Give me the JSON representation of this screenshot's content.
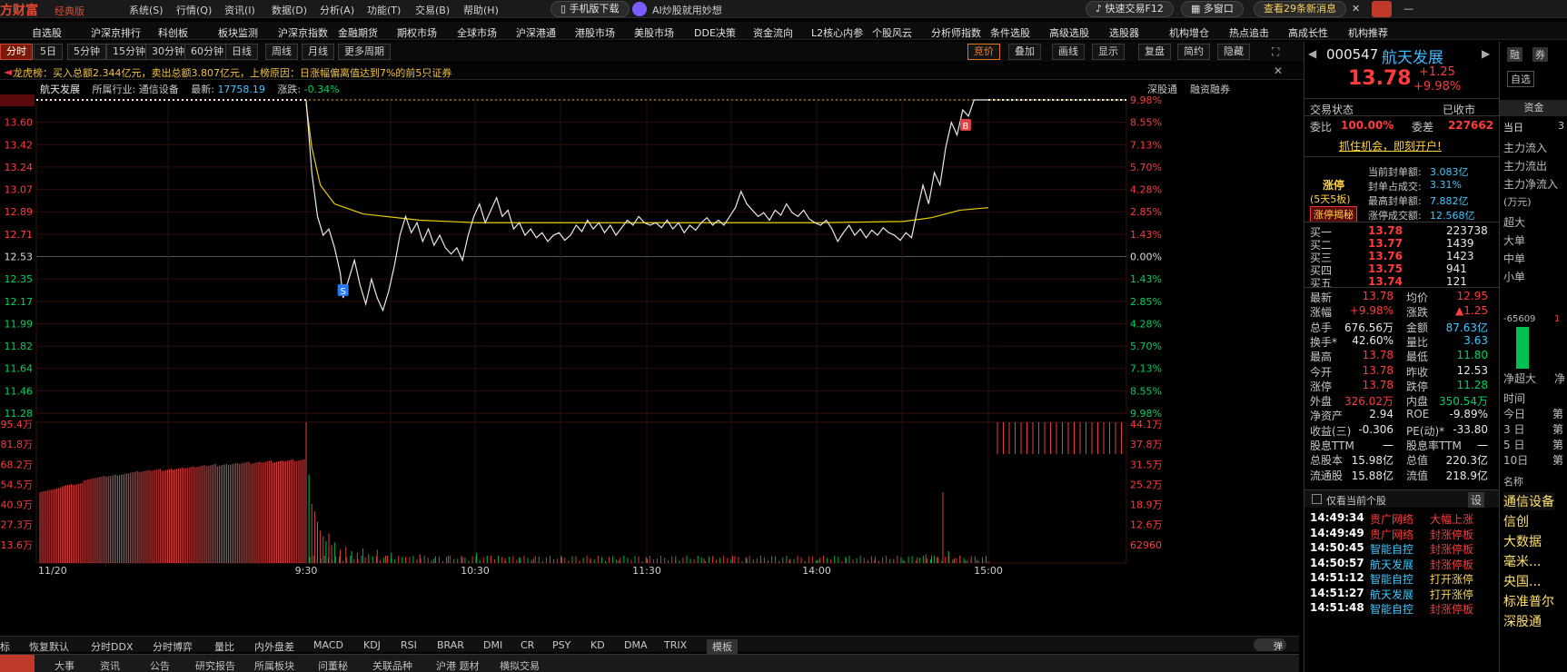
{
  "app": {
    "logo": "方财富",
    "edition": "经典版",
    "menus": [
      "系统(S)",
      "行情(Q)",
      "资讯(I)",
      "数据(D)",
      "分析(A)",
      "功能(T)",
      "交易(B)",
      "帮助(H)"
    ],
    "mobile_download": "手机版下载",
    "ai_label": "AI炒股就用妙想",
    "fast_trade": "快速交易F12",
    "multi_window": "多窗口",
    "messages": "查看29条新消息"
  },
  "nav": [
    "自选股",
    "沪深京排行",
    "科创板",
    "板块监测",
    "沪深京指数",
    "金融期货",
    "期权市场",
    "全球市场",
    "沪深港通",
    "港股市场",
    "美股市场",
    "DDE决策",
    "资金流向",
    "L2核心内参",
    "个股风云",
    "分析师指数",
    "条件选股",
    "高级选股",
    "选股器",
    "机构增仓",
    "热点追击",
    "高成长性",
    "机构推荐"
  ],
  "periods": [
    "分时",
    "5日",
    "5分钟",
    "15分钟",
    "30分钟",
    "60分钟",
    "日线",
    "周线",
    "月线",
    "更多周期"
  ],
  "chart_tools": [
    "竞价",
    "叠加",
    "画线",
    "显示",
    "复盘",
    "简约",
    "隐藏"
  ],
  "notice": "龙虎榜：买入总额2.344亿元，卖出总额3.807亿元，上榜原因：日涨幅偏离值达到7%的前5只证券",
  "chart_header": {
    "name": "航天发展",
    "industry_label": "所属行业:",
    "industry": "通信设备",
    "latest_label": "最新:",
    "latest": "17758.19",
    "change_label": "涨跌:",
    "change": "-0.34%",
    "right1": "深股通",
    "right2": "融资融券"
  },
  "chart_data": {
    "type": "line",
    "price_ticks": [
      "13.78",
      "13.60",
      "13.42",
      "13.24",
      "13.07",
      "12.89",
      "12.71",
      "12.53",
      "12.35",
      "12.17",
      "11.99",
      "11.82",
      "11.64",
      "11.46",
      "11.28"
    ],
    "pct_ticks": [
      "9.98%",
      "8.55%",
      "7.13%",
      "5.70%",
      "4.28%",
      "2.85%",
      "1.43%",
      "0.00%",
      "1.43%",
      "2.85%",
      "4.28%",
      "5.70%",
      "7.13%",
      "8.55%",
      "9.98%"
    ],
    "vol_ticks": [
      "95.4万",
      "81.8万",
      "68.2万",
      "54.5万",
      "40.9万",
      "27.3万",
      "13.6万"
    ],
    "vol_right_ticks": [
      "44.1万",
      "37.8万",
      "31.5万",
      "25.2万",
      "18.9万",
      "12.6万",
      "62960"
    ],
    "time_ticks": [
      "11/20",
      "9:30",
      "10:30",
      "11:30",
      "14:00",
      "15:00"
    ],
    "y_range": [
      11.28,
      13.78
    ],
    "prev_close": 12.53,
    "price_series": [
      [
        0,
        13.78
      ],
      [
        2,
        13.2
      ],
      [
        4,
        12.85
      ],
      [
        6,
        12.7
      ],
      [
        8,
        12.75
      ],
      [
        10,
        12.6
      ],
      [
        12,
        12.4
      ],
      [
        13,
        12.2
      ],
      [
        15,
        12.35
      ],
      [
        17,
        12.5
      ],
      [
        19,
        12.3
      ],
      [
        21,
        12.15
      ],
      [
        23,
        12.35
      ],
      [
        25,
        12.2
      ],
      [
        27,
        12.1
      ],
      [
        29,
        12.25
      ],
      [
        31,
        12.45
      ],
      [
        33,
        12.7
      ],
      [
        35,
        12.85
      ],
      [
        37,
        12.72
      ],
      [
        39,
        12.8
      ],
      [
        41,
        12.65
      ],
      [
        43,
        12.75
      ],
      [
        45,
        12.62
      ],
      [
        47,
        12.7
      ],
      [
        49,
        12.6
      ],
      [
        51,
        12.55
      ],
      [
        53,
        12.6
      ],
      [
        55,
        12.5
      ],
      [
        57,
        12.7
      ],
      [
        59,
        12.85
      ],
      [
        61,
        12.95
      ],
      [
        63,
        12.8
      ],
      [
        65,
        12.9
      ],
      [
        67,
        13.0
      ],
      [
        69,
        12.85
      ],
      [
        71,
        12.9
      ],
      [
        73,
        12.75
      ],
      [
        75,
        12.8
      ],
      [
        77,
        12.7
      ],
      [
        79,
        12.75
      ],
      [
        81,
        12.68
      ],
      [
        83,
        12.72
      ],
      [
        85,
        12.65
      ],
      [
        87,
        12.7
      ],
      [
        89,
        12.72
      ],
      [
        91,
        12.66
      ],
      [
        93,
        12.7
      ],
      [
        95,
        12.78
      ],
      [
        97,
        12.73
      ],
      [
        99,
        12.82
      ],
      [
        101,
        12.75
      ],
      [
        103,
        12.8
      ],
      [
        105,
        12.72
      ],
      [
        107,
        12.78
      ],
      [
        109,
        12.7
      ],
      [
        111,
        12.76
      ],
      [
        113,
        12.82
      ],
      [
        115,
        12.78
      ],
      [
        117,
        12.85
      ],
      [
        119,
        12.8
      ],
      [
        121,
        12.78
      ],
      [
        123,
        12.8
      ],
      [
        125,
        12.76
      ],
      [
        127,
        12.82
      ],
      [
        129,
        12.75
      ],
      [
        131,
        12.8
      ],
      [
        133,
        12.72
      ],
      [
        135,
        12.78
      ],
      [
        137,
        12.74
      ],
      [
        139,
        12.8
      ],
      [
        141,
        12.84
      ],
      [
        143,
        12.78
      ],
      [
        145,
        12.82
      ],
      [
        147,
        12.78
      ],
      [
        149,
        12.85
      ],
      [
        151,
        12.92
      ],
      [
        153,
        13.05
      ],
      [
        155,
        12.95
      ],
      [
        157,
        12.9
      ],
      [
        159,
        12.85
      ],
      [
        161,
        12.88
      ],
      [
        163,
        12.82
      ],
      [
        165,
        12.9
      ],
      [
        167,
        12.86
      ],
      [
        169,
        12.95
      ],
      [
        171,
        12.88
      ],
      [
        173,
        12.85
      ],
      [
        175,
        12.9
      ],
      [
        177,
        12.83
      ],
      [
        179,
        12.8
      ],
      [
        181,
        12.78
      ],
      [
        183,
        12.82
      ],
      [
        185,
        12.75
      ],
      [
        187,
        12.65
      ],
      [
        189,
        12.72
      ],
      [
        191,
        12.78
      ],
      [
        193,
        12.7
      ],
      [
        195,
        12.75
      ],
      [
        197,
        12.68
      ],
      [
        199,
        12.74
      ],
      [
        201,
        12.7
      ],
      [
        203,
        12.76
      ],
      [
        205,
        12.72
      ],
      [
        207,
        12.7
      ],
      [
        209,
        12.66
      ],
      [
        211,
        12.72
      ],
      [
        213,
        12.68
      ],
      [
        215,
        12.9
      ],
      [
        217,
        13.1
      ],
      [
        219,
        12.95
      ],
      [
        221,
        13.2
      ],
      [
        223,
        13.1
      ],
      [
        225,
        13.4
      ],
      [
        227,
        13.6
      ],
      [
        229,
        13.5
      ],
      [
        231,
        13.7
      ],
      [
        233,
        13.65
      ],
      [
        235,
        13.78
      ],
      [
        240,
        13.78
      ]
    ],
    "avg_series": [
      [
        0,
        13.75
      ],
      [
        2,
        13.4
      ],
      [
        5,
        13.1
      ],
      [
        10,
        12.95
      ],
      [
        20,
        12.87
      ],
      [
        40,
        12.82
      ],
      [
        60,
        12.8
      ],
      [
        100,
        12.8
      ],
      [
        140,
        12.8
      ],
      [
        180,
        12.8
      ],
      [
        210,
        12.81
      ],
      [
        220,
        12.84
      ],
      [
        230,
        12.9
      ],
      [
        240,
        12.92
      ]
    ],
    "volume_series": [
      [
        0,
        95.4
      ],
      [
        1,
        60
      ],
      [
        2,
        40
      ],
      [
        3,
        35
      ],
      [
        4,
        28
      ],
      [
        5,
        22
      ],
      [
        6,
        18
      ],
      [
        7,
        15
      ],
      [
        8,
        20
      ],
      [
        9,
        12
      ],
      [
        10,
        14
      ],
      [
        12,
        9
      ],
      [
        14,
        11
      ],
      [
        16,
        8
      ],
      [
        18,
        7
      ],
      [
        20,
        10
      ],
      [
        22,
        6
      ],
      [
        25,
        9
      ],
      [
        28,
        5
      ],
      [
        30,
        7
      ],
      [
        35,
        4
      ],
      [
        40,
        6
      ],
      [
        45,
        3
      ],
      [
        50,
        5
      ],
      [
        55,
        4
      ],
      [
        60,
        7
      ],
      [
        65,
        5
      ],
      [
        70,
        3
      ],
      [
        75,
        4
      ],
      [
        80,
        3
      ],
      [
        90,
        4
      ],
      [
        100,
        3
      ],
      [
        110,
        2
      ],
      [
        120,
        3
      ],
      [
        130,
        2
      ],
      [
        140,
        3
      ],
      [
        150,
        5
      ],
      [
        155,
        3
      ],
      [
        160,
        2
      ],
      [
        170,
        2
      ],
      [
        180,
        2
      ],
      [
        190,
        3
      ],
      [
        200,
        2
      ],
      [
        210,
        2
      ],
      [
        215,
        4
      ],
      [
        218,
        6
      ],
      [
        220,
        5
      ],
      [
        222,
        4
      ],
      [
        224,
        48
      ],
      [
        226,
        8
      ],
      [
        228,
        3
      ],
      [
        230,
        5
      ],
      [
        232,
        2
      ],
      [
        234,
        3
      ],
      [
        236,
        2
      ],
      [
        238,
        2
      ],
      [
        240,
        1
      ]
    ],
    "auction_volume_series": [
      60,
      62,
      65,
      66,
      70,
      72,
      73,
      74,
      76,
      77,
      78,
      78,
      79,
      80,
      81,
      82,
      82,
      83,
      84,
      84,
      85,
      85,
      86,
      86
    ],
    "markers": [
      {
        "label": "S",
        "x": 13
      },
      {
        "label": "B",
        "x": 232
      }
    ]
  },
  "indicator_tabs": [
    "标",
    "恢复默认",
    "分时DDX",
    "分时博弈",
    "量比",
    "内外盘差",
    "MACD",
    "KDJ",
    "RSI",
    "BRAR",
    "DMI",
    "CR",
    "PSY",
    "KD",
    "DMA",
    "TRIX",
    "模板"
  ],
  "bottom_tabs": [
    "大事",
    "资讯",
    "公告",
    "研究报告",
    "所属板块",
    "问董秘",
    "关联品种",
    "沪港 题材",
    "横拟交易"
  ],
  "stock": {
    "code": "000547",
    "name": "航天发展",
    "price": "13.78",
    "change": "+1.25",
    "change_pct": "+9.98%",
    "status_label": "交易状态",
    "status": "已收市",
    "weibi_label": "委比",
    "weibi": "100.00%",
    "weicha_label": "委差",
    "weicha": "227662",
    "promo": "抓住机会，即刻开户!",
    "limit_label": "涨停",
    "limit_sub": "(5天5板)",
    "limit_btn": "涨停揭秘",
    "limit_stats": [
      {
        "label": "当前封单额:",
        "value": "3.083亿"
      },
      {
        "label": "封单占成交:",
        "value": "3.31%"
      },
      {
        "label": "最高封单额:",
        "value": "7.882亿"
      },
      {
        "label": "涨停成交额:",
        "value": "12.568亿"
      }
    ],
    "order_book": [
      {
        "label": "买一",
        "price": "13.78",
        "vol": "223738"
      },
      {
        "label": "买二",
        "price": "13.77",
        "vol": "1439"
      },
      {
        "label": "买三",
        "price": "13.76",
        "vol": "1423"
      },
      {
        "label": "买四",
        "price": "13.75",
        "vol": "941"
      },
      {
        "label": "买五",
        "price": "13.74",
        "vol": "121"
      }
    ],
    "stats": [
      [
        "最新",
        "13.78",
        "均价",
        "12.95"
      ],
      [
        "涨幅",
        "+9.98%",
        "涨跌",
        "▲1.25"
      ],
      [
        "总手",
        "676.56万",
        "金额",
        "87.63亿"
      ],
      [
        "换手*",
        "42.60%",
        "量比",
        "3.63"
      ],
      [
        "最高",
        "13.78",
        "最低",
        "11.80"
      ],
      [
        "今开",
        "13.78",
        "昨收",
        "12.53"
      ],
      [
        "涨停",
        "13.78",
        "跌停",
        "11.28"
      ],
      [
        "外盘",
        "326.02万",
        "内盘",
        "350.54万"
      ],
      [
        "净资产",
        "2.94",
        "ROE",
        "-9.89%"
      ],
      [
        "收益(三)",
        "-0.306",
        "PE(动)*",
        "-33.80"
      ],
      [
        "股息TTM",
        "一",
        "股息率TTM",
        "一"
      ],
      [
        "总股本",
        "15.98亿",
        "总值",
        "220.3亿"
      ],
      [
        "流通股",
        "15.88亿",
        "流值",
        "218.9亿"
      ]
    ],
    "only_current": "仅看当前个股",
    "settings": "设",
    "ticks": [
      {
        "time": "14:49:34",
        "name": "贵广网络",
        "event": "大幅上涨"
      },
      {
        "time": "14:49:49",
        "name": "贵广网络",
        "event": "封涨停板"
      },
      {
        "time": "14:50:45",
        "name": "智能自控",
        "event": "封涨停板"
      },
      {
        "time": "14:50:57",
        "name": "航天发展",
        "event": "封涨停板"
      },
      {
        "time": "14:51:12",
        "name": "智能自控",
        "event": "打开涨停"
      },
      {
        "time": "14:51:27",
        "name": "航天发展",
        "event": "打开涨停"
      },
      {
        "time": "14:51:48",
        "name": "智能自控",
        "event": "封涨停板"
      }
    ]
  },
  "far_panel": {
    "buttons": [
      "融",
      "券",
      "自选"
    ],
    "tabs": [
      "资金",
      "当日",
      "3"
    ],
    "flow": [
      "主力流入",
      "主力流出",
      "主力净流入",
      "(万元)",
      "超大",
      "大单",
      "中单",
      "小单"
    ],
    "bar_label": "-65609",
    "bar_label2": "1",
    "bottom": [
      "净超大",
      "净"
    ],
    "time_rows": [
      "时间",
      "今日",
      "3 日",
      "5 日",
      "10日"
    ],
    "time_vals": [
      "",
      "第",
      "第",
      "第",
      "第"
    ],
    "name_label": "名称",
    "sectors": [
      "通信设备",
      "信创",
      "大数据",
      "毫米...",
      "央国...",
      "标准普尔",
      "深股通"
    ]
  }
}
